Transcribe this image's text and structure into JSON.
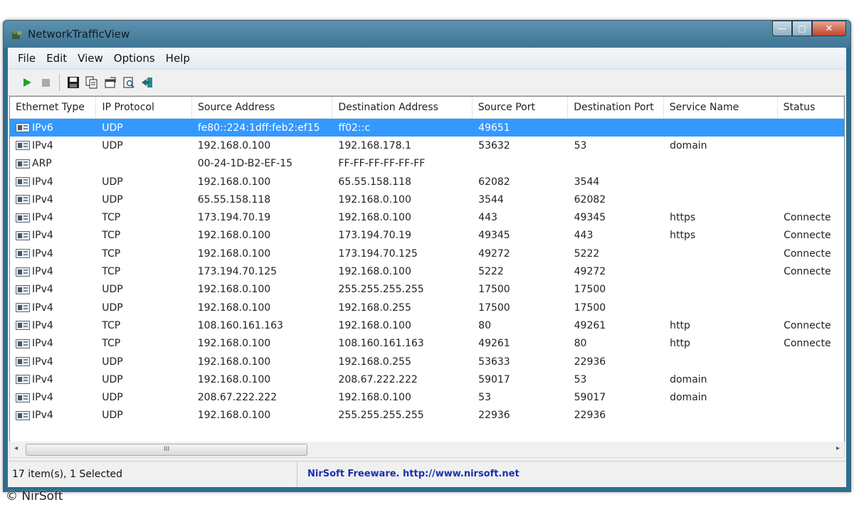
{
  "window": {
    "title": "NetworkTrafficView",
    "buttons": {
      "minimize": "—",
      "maximize": "□",
      "close": "✕"
    }
  },
  "menu": [
    "File",
    "Edit",
    "View",
    "Options",
    "Help"
  ],
  "toolbar": {
    "icons": [
      "play-icon",
      "stop-icon",
      "save-icon",
      "copy-icon",
      "properties-icon",
      "find-icon",
      "exit-icon"
    ]
  },
  "table": {
    "columns": [
      "Ethernet Type",
      "IP Protocol",
      "Source Address",
      "Destination Address",
      "Source Port",
      "Destination Port",
      "Service Name",
      "Status"
    ],
    "rows": [
      [
        "IPv6",
        "UDP",
        "fe80::224:1dff:feb2:ef15",
        "ff02::c",
        "49651",
        "",
        "",
        ""
      ],
      [
        "IPv4",
        "UDP",
        "192.168.0.100",
        "192.168.178.1",
        "53632",
        "53",
        "domain",
        ""
      ],
      [
        "ARP",
        "",
        "00-24-1D-B2-EF-15",
        "FF-FF-FF-FF-FF-FF",
        "",
        "",
        "",
        ""
      ],
      [
        "IPv4",
        "UDP",
        "192.168.0.100",
        "65.55.158.118",
        "62082",
        "3544",
        "",
        ""
      ],
      [
        "IPv4",
        "UDP",
        "65.55.158.118",
        "192.168.0.100",
        "3544",
        "62082",
        "",
        ""
      ],
      [
        "IPv4",
        "TCP",
        "173.194.70.19",
        "192.168.0.100",
        "443",
        "49345",
        "https",
        "Connecte"
      ],
      [
        "IPv4",
        "TCP",
        "192.168.0.100",
        "173.194.70.19",
        "49345",
        "443",
        "https",
        "Connecte"
      ],
      [
        "IPv4",
        "TCP",
        "192.168.0.100",
        "173.194.70.125",
        "49272",
        "5222",
        "",
        "Connecte"
      ],
      [
        "IPv4",
        "TCP",
        "173.194.70.125",
        "192.168.0.100",
        "5222",
        "49272",
        "",
        "Connecte"
      ],
      [
        "IPv4",
        "UDP",
        "192.168.0.100",
        "255.255.255.255",
        "17500",
        "17500",
        "",
        ""
      ],
      [
        "IPv4",
        "UDP",
        "192.168.0.100",
        "192.168.0.255",
        "17500",
        "17500",
        "",
        ""
      ],
      [
        "IPv4",
        "TCP",
        "108.160.161.163",
        "192.168.0.100",
        "80",
        "49261",
        "http",
        "Connecte"
      ],
      [
        "IPv4",
        "TCP",
        "192.168.0.100",
        "108.160.161.163",
        "49261",
        "80",
        "http",
        "Connecte"
      ],
      [
        "IPv4",
        "UDP",
        "192.168.0.100",
        "192.168.0.255",
        "53633",
        "22936",
        "",
        ""
      ],
      [
        "IPv4",
        "UDP",
        "192.168.0.100",
        "208.67.222.222",
        "59017",
        "53",
        "domain",
        ""
      ],
      [
        "IPv4",
        "UDP",
        "208.67.222.222",
        "192.168.0.100",
        "53",
        "59017",
        "domain",
        ""
      ],
      [
        "IPv4",
        "UDP",
        "192.168.0.100",
        "255.255.255.255",
        "22936",
        "22936",
        "",
        ""
      ]
    ],
    "selected_row": 0
  },
  "scrollbar": {
    "thumb_grip": "III",
    "left_arrow": "◂",
    "right_arrow": "▸"
  },
  "status": {
    "items": "17 item(s), 1 Selected",
    "link": "NirSoft Freeware.  http://www.nirsoft.net"
  },
  "copyright": "© NirSoft",
  "colors": {
    "selection": "#3399ff",
    "titlebar": "#3f7595",
    "link": "#1a2fb0"
  }
}
